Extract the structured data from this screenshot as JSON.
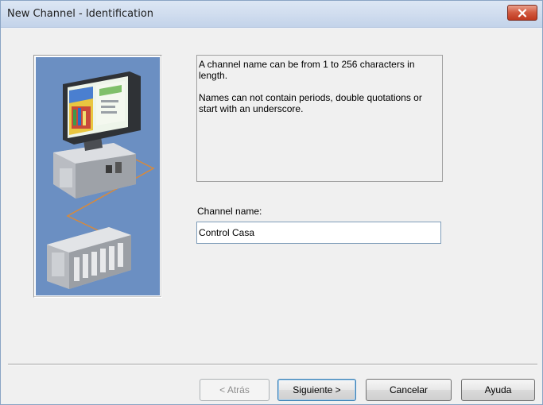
{
  "window": {
    "title": "New Channel - Identification",
    "close_icon": "close-icon"
  },
  "info": {
    "line1": "A channel name can be from 1 to 256 characters in length.",
    "line2": "Names can not contain periods, double quotations or start with an underscore."
  },
  "channel": {
    "label": "Channel name:",
    "value": "Control Casa"
  },
  "buttons": {
    "back": "< Atrás",
    "next": "Siguiente >",
    "cancel": "Cancelar",
    "help": "Ayuda"
  },
  "colors": {
    "illustration_bg": "#6b8fc2",
    "close_button": "#c0391f"
  }
}
